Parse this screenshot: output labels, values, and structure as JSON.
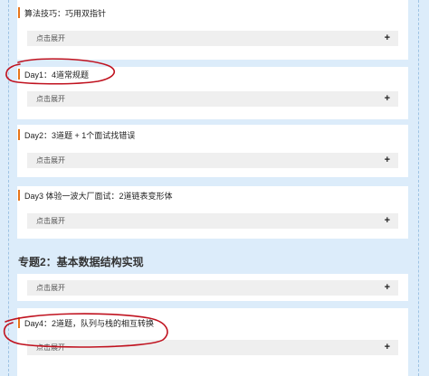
{
  "sections": [
    {
      "title": "算法技巧：巧用双指针",
      "expand_label": "点击展开",
      "expand_icon": "plus-icon"
    },
    {
      "title": "Day1：4道常规题",
      "expand_label": "点击展开",
      "expand_icon": "plus-icon"
    },
    {
      "title": "Day2：3道题 + 1个面试找错误",
      "expand_label": "点击展开",
      "expand_icon": "plus-icon"
    },
    {
      "title": "Day3 体验一波大厂面试：2道链表变形体",
      "expand_label": "点击展开",
      "expand_icon": "plus-icon"
    }
  ],
  "topic2": {
    "title": "专题2：基本数据结构实现"
  },
  "topic2_sections": [
    {
      "title": "",
      "expand_label": "点击展开",
      "expand_icon": "plus-icon"
    },
    {
      "title": "Day4：2道题，队列与栈的相互转换",
      "expand_label": "点击展开",
      "expand_icon": "plus-icon"
    }
  ],
  "plus_glyph": "+",
  "colors": {
    "background": "#dcecfa",
    "accent_bar": "#e8751a",
    "annotation": "#c0121f",
    "expand_bg": "#efefef"
  }
}
